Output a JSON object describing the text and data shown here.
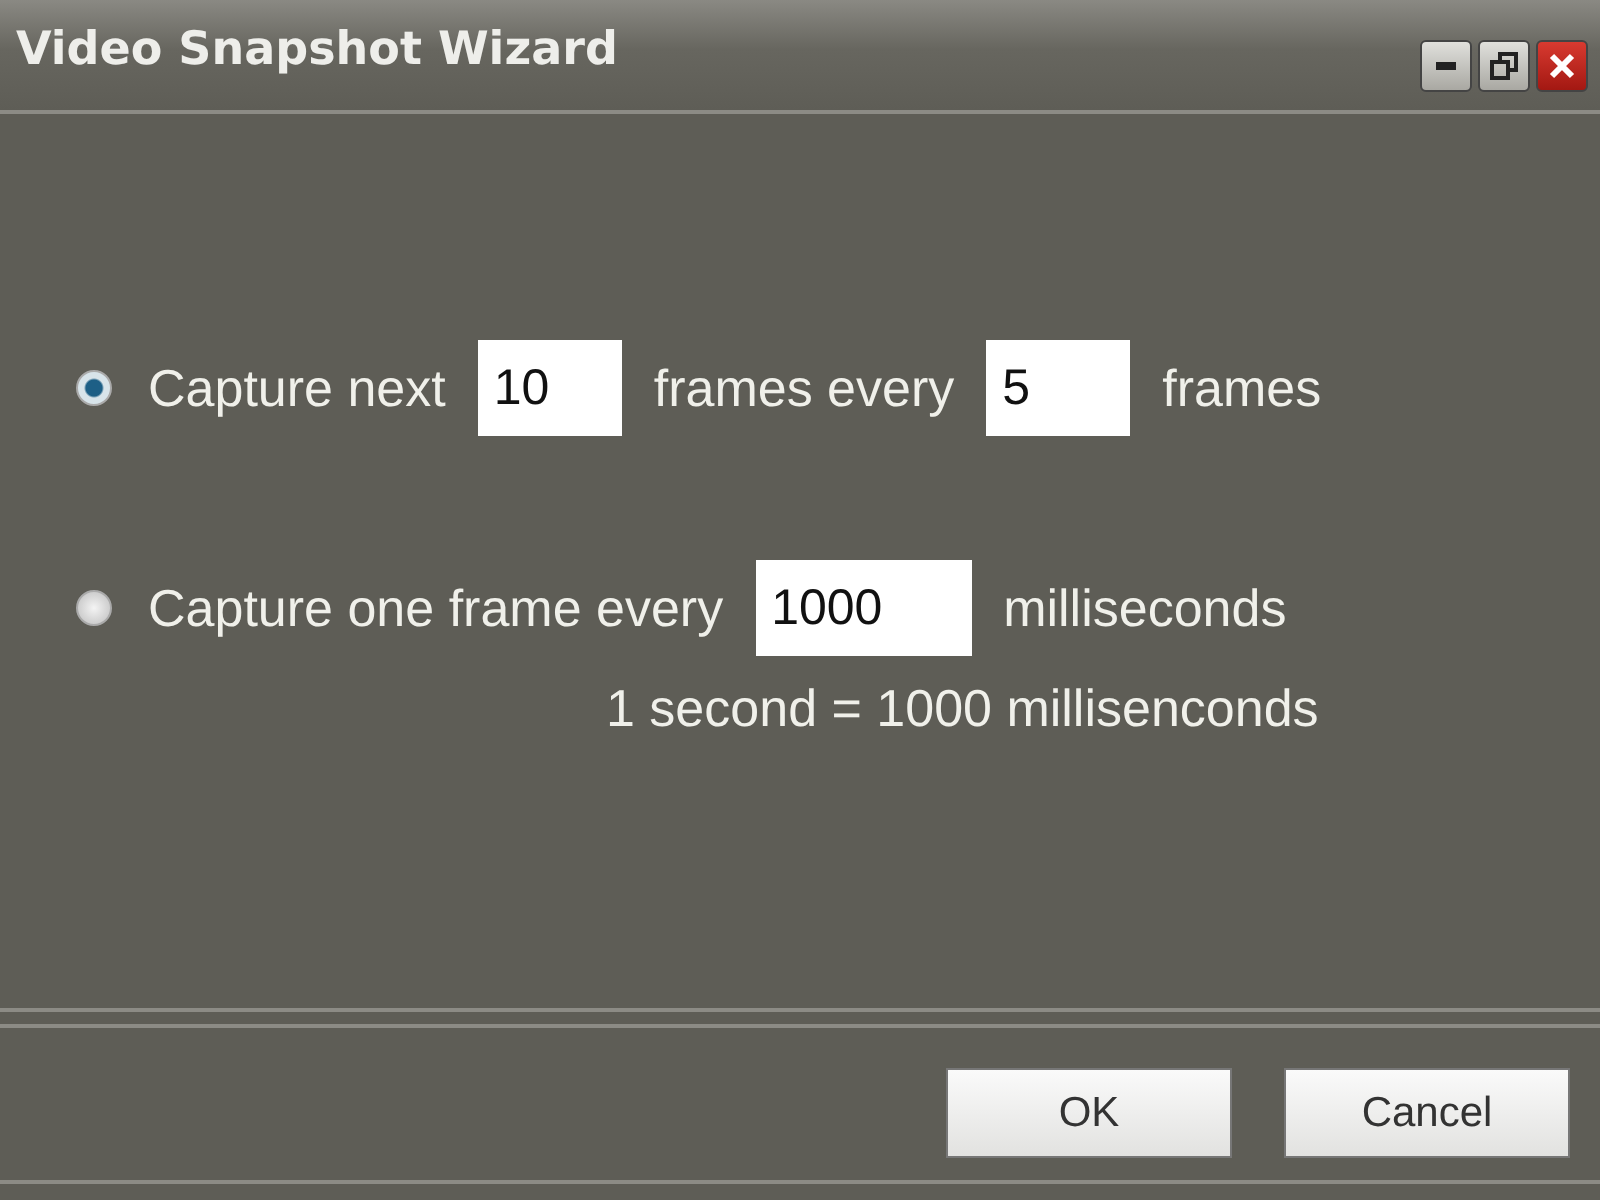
{
  "window": {
    "title": "Video Snapshot Wizard"
  },
  "options": [
    {
      "selected": true,
      "parts": [
        {
          "kind": "text",
          "text": "Capture next"
        },
        {
          "kind": "field",
          "value": "10"
        },
        {
          "kind": "text",
          "text": "frames every"
        },
        {
          "kind": "field",
          "value": "5"
        },
        {
          "kind": "text",
          "text": "frames"
        }
      ]
    },
    {
      "selected": false,
      "parts": [
        {
          "kind": "text",
          "text": "Capture one frame every"
        },
        {
          "kind": "field",
          "value": "1000"
        },
        {
          "kind": "text",
          "text": "milliseconds"
        }
      ]
    }
  ],
  "note": "1 second = 1000 millisenconds",
  "buttons": [
    "OK",
    "Cancel"
  ]
}
